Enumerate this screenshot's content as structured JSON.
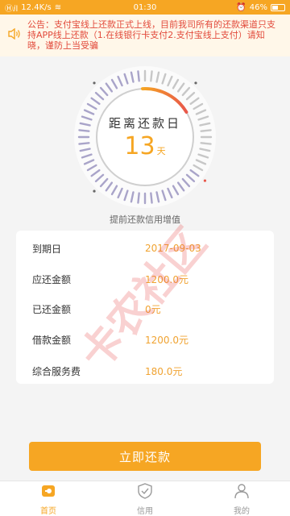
{
  "status_bar": {
    "carrier": "Ⓗⅈl",
    "speed": "12.4K/s",
    "time": "01:30",
    "battery": "46%"
  },
  "notice": {
    "icon": "speaker-icon",
    "text": "公告：支付宝线上还款正式上线，目前我司所有的还款渠道只支持APP线上还款（1.在线银行卡支付2.支付宝线上支付）请知晓，谨防上当受骗"
  },
  "dial": {
    "label": "距离还款日",
    "days": "13",
    "unit": "天",
    "progress": 0.1
  },
  "hint": "提前还款信用增值",
  "details": {
    "rows": [
      {
        "key": "到期日",
        "value": "2017-09-03"
      },
      {
        "key": "应还金额",
        "value": "1200.0元"
      },
      {
        "key": "已还金额",
        "value": "0元"
      },
      {
        "key": "借款金额",
        "value": "1200.0元"
      },
      {
        "key": "综合服务费",
        "value": "180.0元"
      }
    ]
  },
  "pay_button": "立即还款",
  "tabs": [
    {
      "label": "首页",
      "icon": "home-icon",
      "active": true
    },
    {
      "label": "信用",
      "icon": "shield-check-icon",
      "active": false
    },
    {
      "label": "我的",
      "icon": "user-icon",
      "active": false
    }
  ],
  "watermark": "卡农社区",
  "colors": {
    "accent": "#f6a623",
    "notice_text": "#e24a3b",
    "value_text": "#f0a332"
  }
}
